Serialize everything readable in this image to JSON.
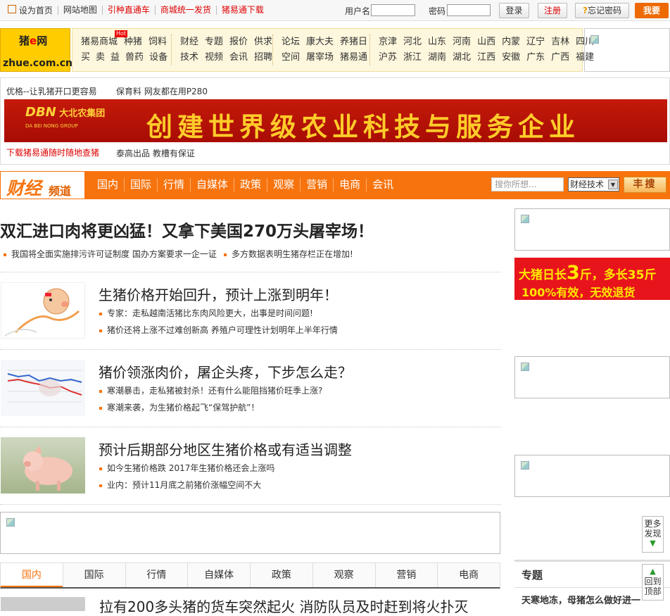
{
  "topbar": {
    "links": [
      "设为首页",
      "网站地图",
      "引种直通车",
      "商城统一发货",
      "猪易通下载"
    ],
    "username_label": "用户名",
    "password_label": "密码",
    "login": "登录",
    "register": "注册",
    "forgot": "忘记密码",
    "iwant": "我要"
  },
  "logo": {
    "top": "猪",
    "mid": "e",
    "net": "网",
    "domain": "zhue.com.cn"
  },
  "nav": {
    "group1": [
      [
        "猪易商城",
        "种猪",
        "饲料"
      ],
      [
        "买",
        "卖",
        "益",
        "兽药",
        "设备"
      ]
    ],
    "group2": [
      [
        "财经",
        "专题",
        "报价",
        "供求"
      ],
      [
        "技术",
        "视频",
        "会讯",
        "招聘"
      ]
    ],
    "group3": [
      [
        "论坛",
        "康大夫",
        "养猪日"
      ],
      [
        "空间",
        "屠宰场",
        "猪易通"
      ]
    ],
    "group4": [
      [
        "京津",
        "河北",
        "山东",
        "河南",
        "山西",
        "内蒙",
        "辽宁",
        "吉林",
        "四川"
      ],
      [
        "沪苏",
        "浙江",
        "湖南",
        "湖北",
        "江西",
        "安徽",
        "广东",
        "广西",
        "福建"
      ]
    ],
    "hot": "Hot"
  },
  "notice": {
    "t1": "优格--让乳猪开口更容易",
    "t2": "保育料 网友都在用P280",
    "banner_brand": "大北农集团",
    "banner_brand_logo": "DBN",
    "banner_brand_en": "DA BEI NONG GROUP",
    "banner_slogan": "创建世界级农业科技与服务企业",
    "t3": "下载猪易通随时随地查猪",
    "t4": "泰高出品 教槽有保证"
  },
  "channel": {
    "logo_big": "财经",
    "logo_small": "频道",
    "tabs": [
      "国内",
      "国际",
      "行情",
      "自媒体",
      "政策",
      "观察",
      "营销",
      "电商",
      "会讯"
    ],
    "search_placeholder": "搜你所想...",
    "select_value": "财经技术",
    "search_button": "丰搜"
  },
  "main": {
    "headline": "双汇进口肉将更凶猛！又拿下美国270万头屠宰场！",
    "sublines": [
      "我国将全面实施排污许可证制度 国办方案要求一企一证",
      "多方数据表明生猪存栏正在增加!"
    ],
    "items": [
      {
        "title": "生猪价格开始回升，预计上涨到明年！",
        "subs": [
          "专家：走私越南活猪比东肉风险更大，出事是时间问题!",
          "猪价还将上涨不过难创新高 养殖户可理性计划明年上半年行情"
        ]
      },
      {
        "title": "猪价领涨肉价，屠企头疼，下步怎么走？",
        "subs": [
          "寒潮暴击，走私猪被封杀！还有什么能阻挡猪价旺季上涨?",
          "寒潮来袭，为生猪价格起飞“保驾护航”！"
        ]
      },
      {
        "title": "预计后期部分地区生猪价格或有适当调整",
        "subs": [
          "如今生猪价格跌 2017年生猪价格还会上涨吗",
          "业内：预计11月底之前猪价涨幅空间不大"
        ]
      }
    ],
    "tabs": [
      "国内",
      "国际",
      "行情",
      "自媒体",
      "政策",
      "观察",
      "营销",
      "电商"
    ],
    "last_title": "拉有200多头猪的货车突然起火 消防队员及时赶到将火扑灭"
  },
  "right": {
    "ad_line1_pre": "大猪日长",
    "ad_line1_num": "3",
    "ad_line1_post": "斤，多长35斤",
    "ad_line2": "100%有效，无效退货",
    "zhuanti_title": "专题",
    "zhuanti_item": "天寒地冻，母猪怎么做好进一",
    "more": "更多发现",
    "back": "回到顶部"
  },
  "colors": {
    "brand_orange": "#f7730d",
    "banner_red": "#c41a0a",
    "link_red": "#dd0000"
  }
}
